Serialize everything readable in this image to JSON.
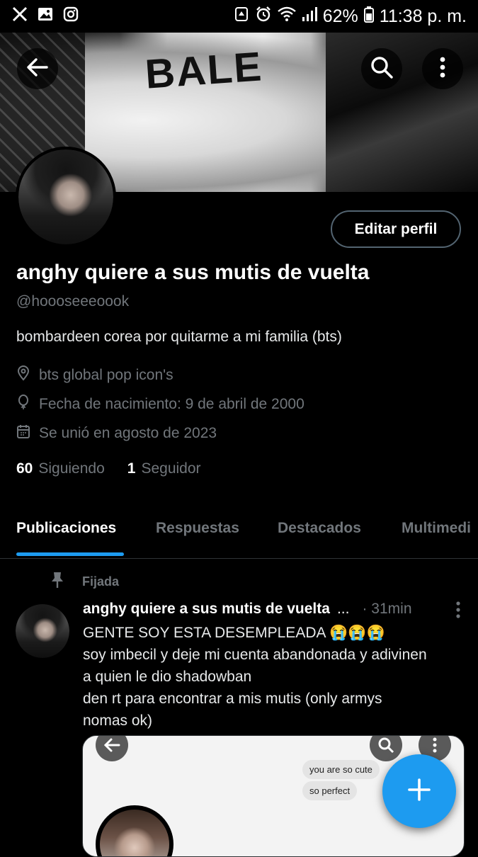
{
  "status_bar": {
    "battery": "62%",
    "time": "11:38 p. m.",
    "left_icons": [
      "x-logo-icon",
      "gallery-icon",
      "instagram-icon"
    ],
    "right_icons": [
      "recycle-icon",
      "alarm-icon",
      "wifi-icon",
      "signal-icon",
      "battery-icon"
    ]
  },
  "banner": {
    "text": "BALE"
  },
  "profile": {
    "display_name": "anghy quiere a sus mutis de vuelta",
    "handle": "@hoooseeeoook",
    "bio": "bombardeen corea por quitarme a mi familia (bts)",
    "location": "bts global pop icon's",
    "birthday": "Fecha de nacimiento: 9 de abril de 2000",
    "joined": "Se unió en agosto de 2023",
    "following_count": "60",
    "following_label": "Siguiendo",
    "followers_count": "1",
    "followers_label": "Seguidor",
    "edit_button": "Editar perfil"
  },
  "tabs": [
    {
      "label": "Publicaciones",
      "active": true
    },
    {
      "label": "Respuestas",
      "active": false
    },
    {
      "label": "Destacados",
      "active": false
    },
    {
      "label": "Multimedi",
      "active": false
    }
  ],
  "pinned_post": {
    "pinned_label": "Fijada",
    "author": "anghy quiere a sus mutis de vuelta",
    "ellipsis": "...",
    "time": "· 31min",
    "lines": [
      "GENTE SOY ESTA DESEMPLEADA 😭😭😭",
      "soy imbecil y deje mi cuenta abandonada y adivinen",
      "a quien le dio shadowban",
      "den rt para encontrar a mis mutis (only armys",
      "nomas ok)"
    ],
    "media": {
      "bubbles": [
        "you are so cute",
        "so perfect"
      ]
    }
  },
  "colors": {
    "accent": "#1d9bf0",
    "background": "#000000",
    "secondary_text": "#71767b"
  }
}
